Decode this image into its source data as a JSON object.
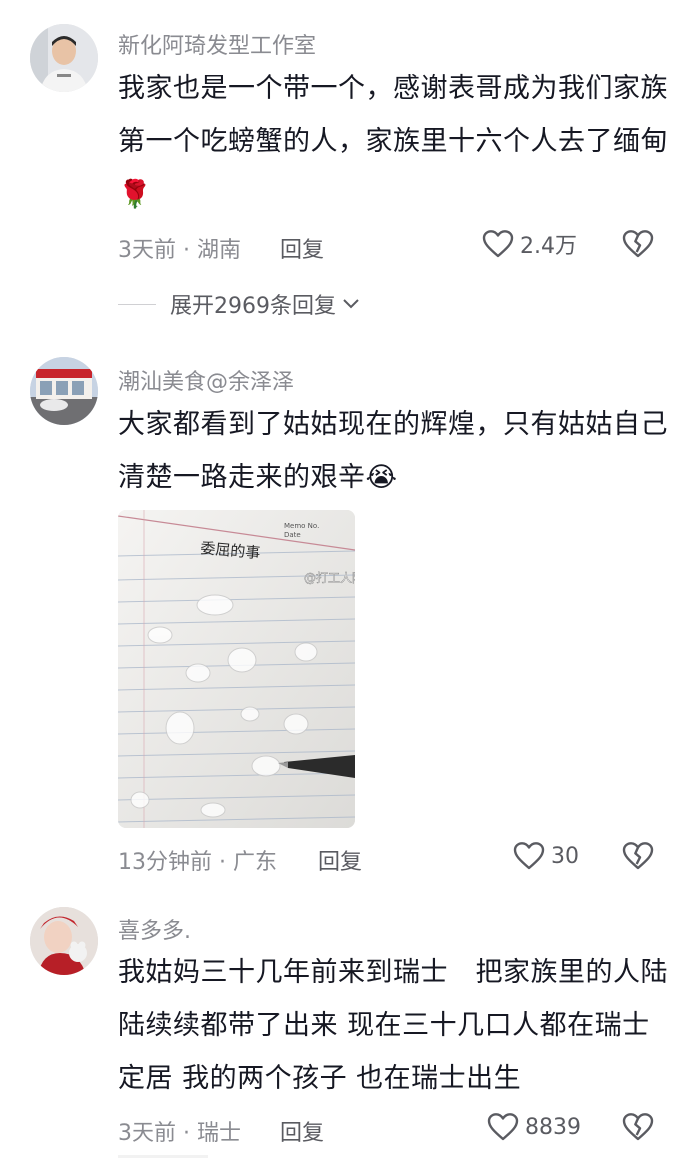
{
  "comments": [
    {
      "username": "新化阿琦发型工作室",
      "text": "我家也是一个带一个，感谢表哥成为我们家族第一个吃螃蟹的人，家族里十六个人去了缅甸",
      "emoji": "🌹",
      "meta": "3天前 · 湖南",
      "reply_label": "回复",
      "likes": "2.4万",
      "expand_label": "展开2969条回复"
    },
    {
      "username": "潮汕美食@余泽泽",
      "text": "大家都看到了姑姑现在的辉煌，只有姑姑自己清楚一路走来的艰辛",
      "emoji": "😭",
      "image": {
        "handwriting": "委屈的事",
        "memo_label": "Memo No.",
        "date_label": "Date",
        "watermark": "@打工人阿卷"
      },
      "meta": "13分钟前 · 广东",
      "reply_label": "回复",
      "likes": "30"
    },
    {
      "username": "喜多多.",
      "text": "我姑妈三十几年前来到瑞士　把家族里的人陆陆续续都带了出来 现在三十几口人都在瑞士定居 我的两个孩子 也在瑞士出生",
      "meta": "3天前 · 瑞士",
      "reply_label": "回复",
      "likes": "8839"
    }
  ],
  "icons": {
    "like": "heart-outline-icon",
    "dislike": "broken-heart-icon",
    "expand": "chevron-down-icon"
  },
  "colors": {
    "text": "#161823",
    "meta": "#8a8b91",
    "secondary": "#5a5b61"
  }
}
